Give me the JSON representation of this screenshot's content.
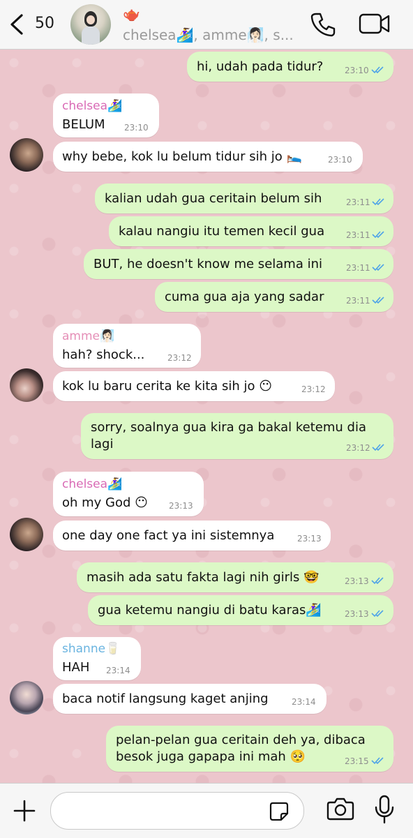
{
  "header": {
    "back_count": "50",
    "group_emoji": "🫖",
    "members": "chelsea🏄‍♀️, amme🧖🏻‍♀️, s..."
  },
  "messages": [
    {
      "dir": "out",
      "text": "hi, udah pada tidur?",
      "time": "23:10",
      "read": true
    },
    {
      "dir": "in",
      "sender": "chelsea🏄‍♀️",
      "sender_color": "#d96ab5",
      "text": "BELUM",
      "time": "23:10"
    },
    {
      "dir": "in",
      "text": "why bebe, kok lu belum tidur sih jo 🛌",
      "time": "23:10"
    },
    {
      "dir": "out",
      "text": "kalian udah gua ceritain belum sih",
      "time": "23:11",
      "read": true
    },
    {
      "dir": "out",
      "text": "kalau nangiu itu temen kecil gua",
      "time": "23:11",
      "read": true
    },
    {
      "dir": "out",
      "text": "BUT, he doesn't know me selama ini",
      "time": "23:11",
      "read": true
    },
    {
      "dir": "out",
      "text": "cuma gua aja yang sadar",
      "time": "23:11",
      "read": true
    },
    {
      "dir": "in",
      "sender": "amme🧖🏻‍♀️",
      "sender_color": "#e58fb7",
      "text": "hah? shock...",
      "time": "23:12"
    },
    {
      "dir": "in",
      "text": "kok lu baru cerita ke kita sih jo 😶",
      "time": "23:12"
    },
    {
      "dir": "out",
      "text": "sorry, soalnya gua kira ga bakal ketemu dia",
      "text2": "lagi",
      "time": "23:12",
      "read": true
    },
    {
      "dir": "in",
      "sender": "chelsea🏄‍♀️",
      "sender_color": "#d96ab5",
      "text": "oh my God 😶",
      "time": "23:13"
    },
    {
      "dir": "in",
      "text": "one day one fact ya ini sistemnya",
      "time": "23:13"
    },
    {
      "dir": "out",
      "text": "masih ada satu fakta lagi nih girls 🤓",
      "time": "23:13",
      "read": true
    },
    {
      "dir": "out",
      "text": "gua ketemu nangiu di batu karas🏄‍♀️",
      "time": "23:13",
      "read": true
    },
    {
      "dir": "in",
      "sender": "shanne🥛",
      "sender_color": "#6ab4e0",
      "text": "HAH",
      "time": "23:14"
    },
    {
      "dir": "in",
      "text": "baca notif langsung kaget anjing",
      "time": "23:14"
    },
    {
      "dir": "out",
      "text": "pelan-pelan gua ceritain deh ya, dibaca",
      "text2": "besok juga gapapa ini mah 🥺",
      "time": "23:15",
      "read": true
    }
  ],
  "input": {
    "value": ""
  },
  "colors": {
    "outgoing": "#dcf8c6",
    "incoming": "#ffffff",
    "ticks": "#4fa3e8",
    "background": "#ecc6cc"
  }
}
